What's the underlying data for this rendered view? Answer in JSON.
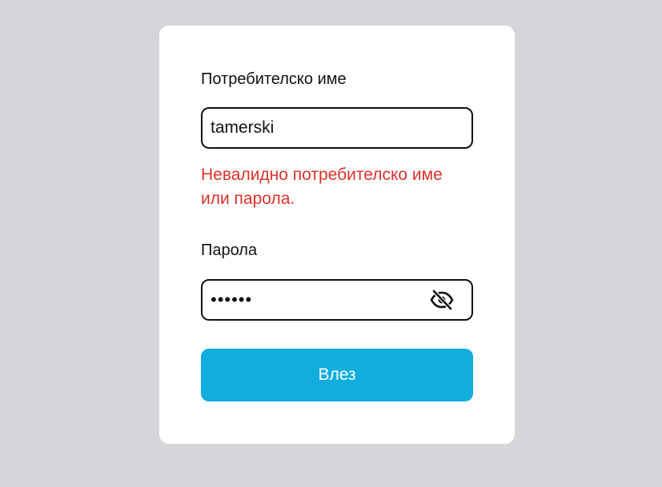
{
  "login_form": {
    "username_label": "Потребителско име",
    "username_value": "tamerski",
    "error_message": "Невалидно потребителско име или парола.",
    "password_label": "Парола",
    "password_value": "••••••",
    "submit_label": "Влез",
    "password_toggle_icon": "eye-slash-icon"
  },
  "colors": {
    "background": "#d5d5da",
    "card": "#ffffff",
    "error": "#d8322b",
    "button": "#10addd",
    "button_text": "#ffffff",
    "border": "#111111"
  }
}
